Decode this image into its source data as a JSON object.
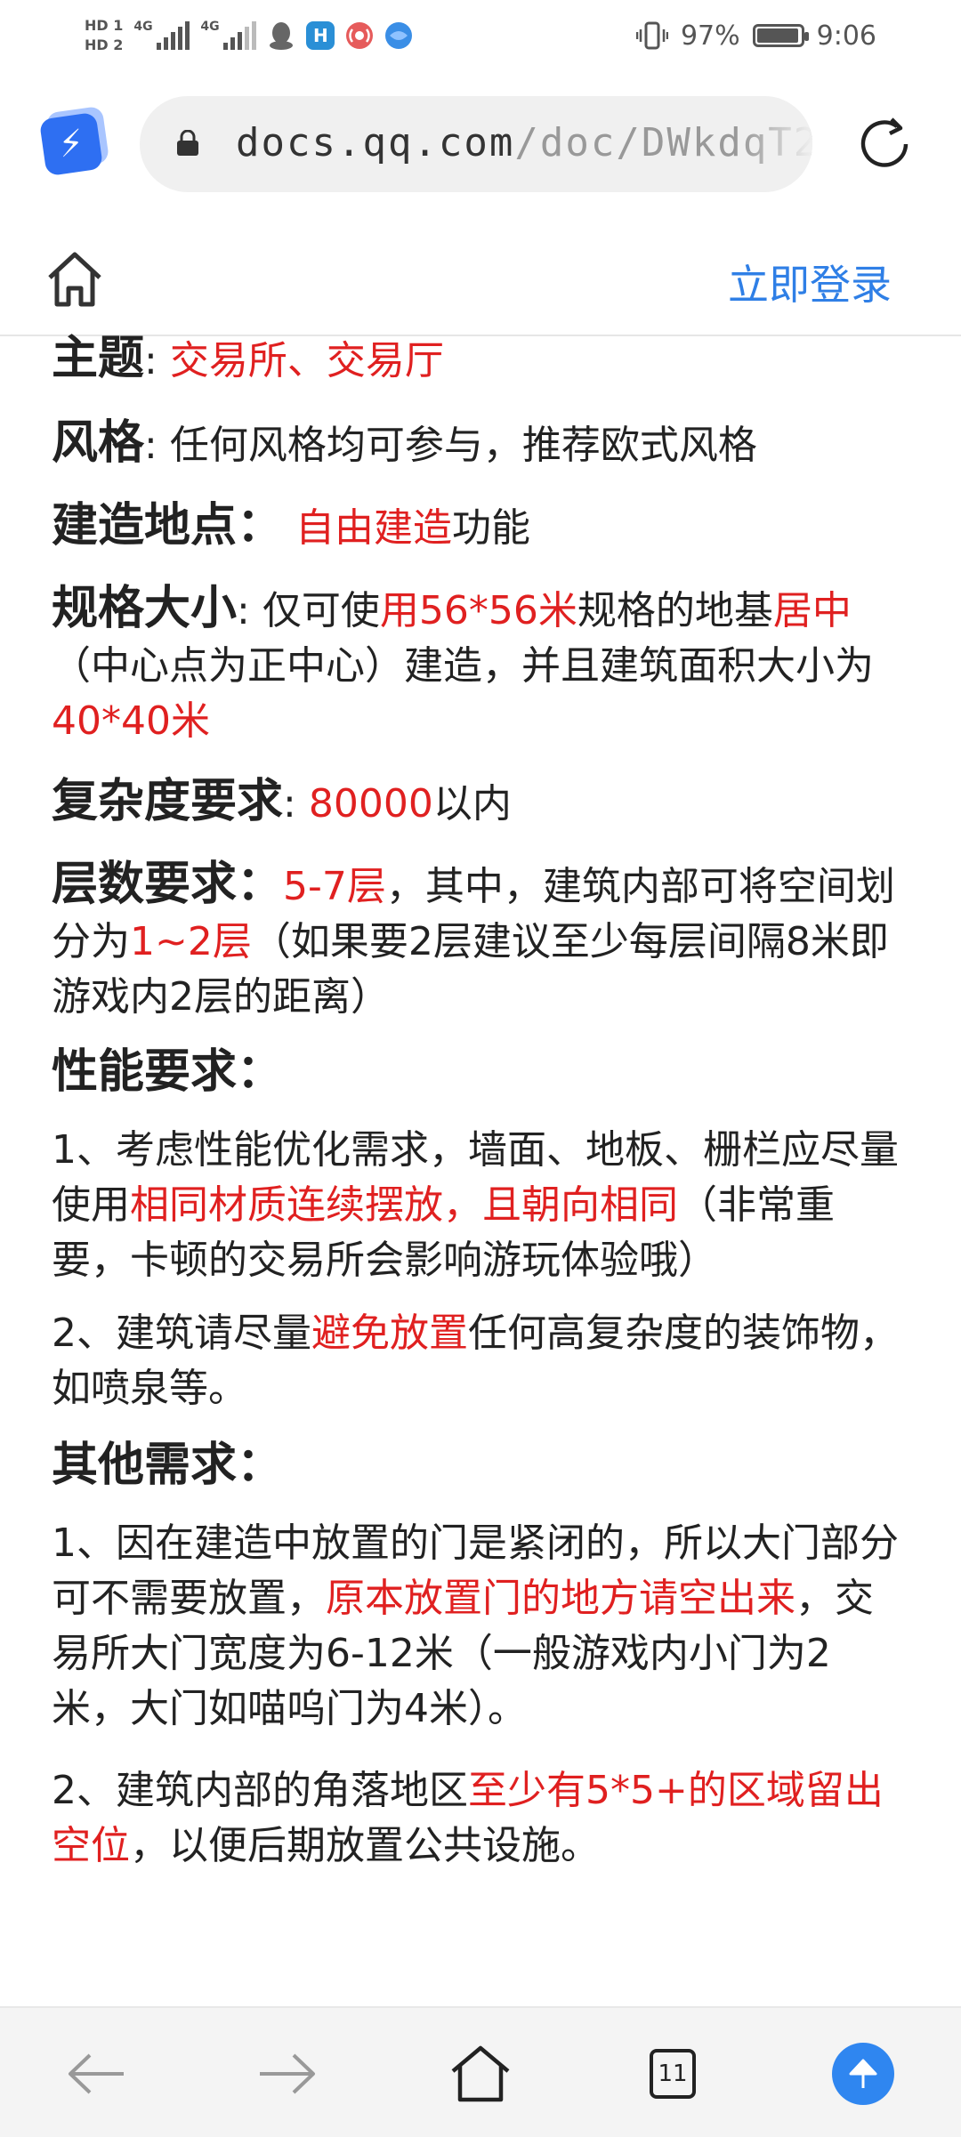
{
  "status_bar": {
    "hd1": "HD 1",
    "hd2": "HD 2",
    "net1": "4G",
    "net2": "4G",
    "app_icon_label": "H",
    "battery_text": "97%",
    "battery_level": 0.97,
    "time": "9:06"
  },
  "browser": {
    "url_host": "docs.qq.com",
    "url_path": "/doc/DWkdqT2"
  },
  "doc_header": {
    "login_label": "立即登录"
  },
  "content": {
    "theme": {
      "label": "主题",
      "sep": ":",
      "value": "交易所、交易厅"
    },
    "style": {
      "label": "风格",
      "sep": ":",
      "text": "任何风格均可参与，推荐欧式风格"
    },
    "site": {
      "label": "建造地点：",
      "red": "自由建造",
      "text": "功能"
    },
    "size": {
      "label": "规格大小",
      "sep": ":",
      "t1": "仅可使",
      "r1": "用56*56米",
      "t2": "规格的地基",
      "r2": "居中",
      "t3": "（中心点为正中心）建造，并且建筑面积大小为",
      "r3": "40*40米"
    },
    "complexity": {
      "label": "复杂度要求",
      "sep": ":",
      "red": "80000",
      "text": "以内"
    },
    "floors": {
      "label": "层数要求：",
      "r1": "5-7层",
      "t1": "，其中，建筑内部可将空间划分为",
      "r2": "1~2层",
      "t2": "（如果要2层建议至少每层间隔8米即游戏内2层的距离）"
    },
    "performance": {
      "heading": "性能要求：",
      "item1_t1": "1、考虑性能优化需求，墙面、地板、栅栏应尽量使用",
      "item1_red": "相同材质连续摆放，且朝向相同",
      "item1_t2": "（非常重要，卡顿的交易所会影响游玩体验哦）",
      "item2_t1": "2、建筑请尽量",
      "item2_red": "避免放置",
      "item2_t2": "任何高复杂度的装饰物，如喷泉等。"
    },
    "other": {
      "heading": "其他需求：",
      "item1_t1": "1、因在建造中放置的门是紧闭的，所以大门部分可不需要放置，",
      "item1_red": "原本放置门的地方请空出来",
      "item1_t2": "，交易所大门宽度为6-12米（一般游戏内小门为2米，大门如喵呜门为4米）。",
      "item2_t1": "2、建筑内部的角落地区",
      "item2_red": "至少有5*5+的区域留出空位",
      "item2_t2": "，以便后期放置公共设施。"
    }
  },
  "bottom_bar": {
    "tabs_count": "11"
  }
}
